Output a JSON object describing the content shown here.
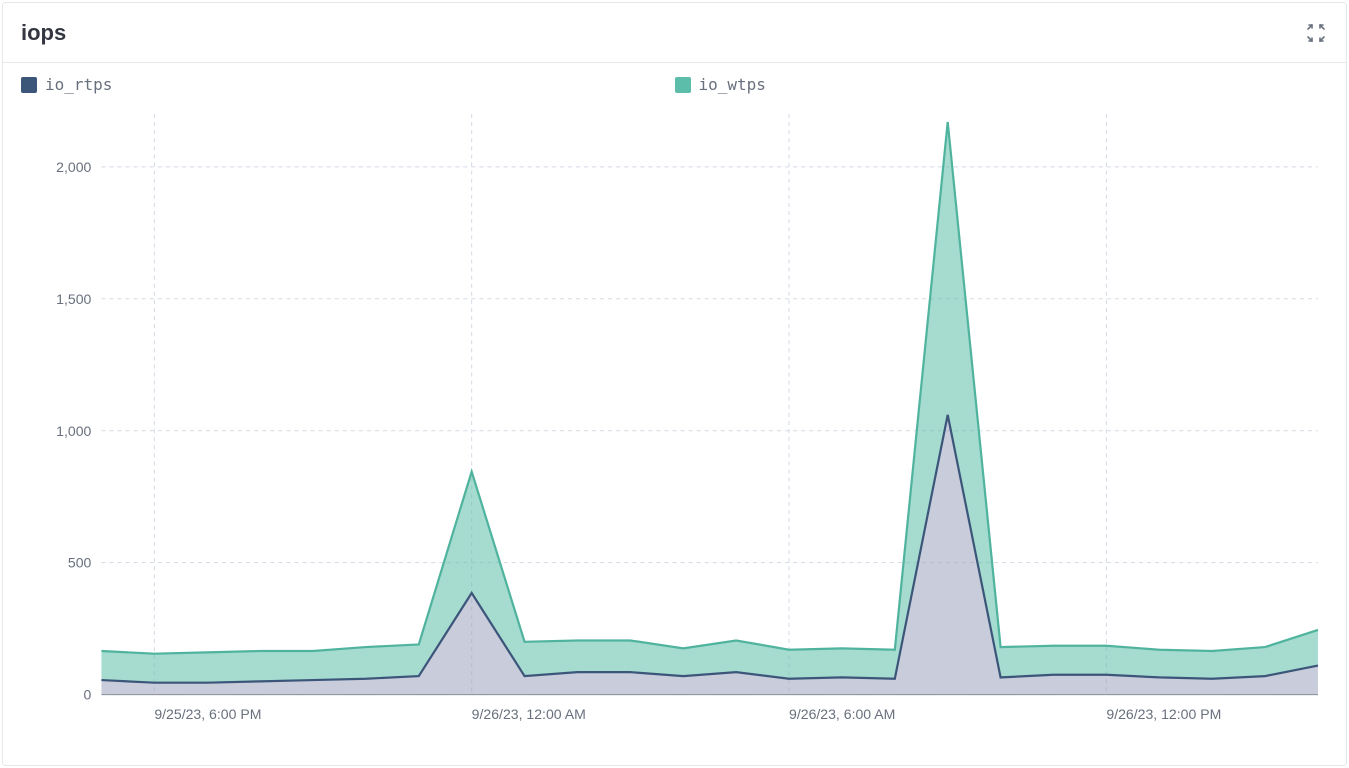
{
  "header": {
    "title": "iops",
    "collapse_icon": "collapse-icon"
  },
  "legend": {
    "items": [
      {
        "name": "io_rtps",
        "color": "#3c567a"
      },
      {
        "name": "io_wtps",
        "color": "#5cbeaa"
      }
    ]
  },
  "chart_data": {
    "type": "area",
    "title": "iops",
    "xlabel": "",
    "ylabel": "",
    "ylim": [
      0,
      2200
    ],
    "y_ticks": [
      0,
      500,
      1000,
      1500,
      2000
    ],
    "x_tick_labels": [
      "9/25/23, 6:00 PM",
      "9/26/23, 12:00 AM",
      "9/26/23, 6:00 AM",
      "9/26/23, 12:00 PM"
    ],
    "x_tick_indices": [
      1,
      7,
      13,
      19
    ],
    "x": [
      0,
      1,
      2,
      3,
      4,
      5,
      6,
      7,
      8,
      9,
      10,
      11,
      12,
      13,
      14,
      15,
      16,
      17,
      18,
      19,
      20,
      21,
      22,
      23
    ],
    "series": [
      {
        "name": "io_rtps",
        "color_line": "#3c567a",
        "color_fill": "#9aa3bd",
        "values": [
          55,
          45,
          45,
          50,
          55,
          60,
          70,
          385,
          70,
          85,
          85,
          70,
          85,
          60,
          65,
          60,
          1060,
          65,
          75,
          75,
          65,
          60,
          70,
          110
        ]
      },
      {
        "name": "io_wtps",
        "color_line": "#4fb39e",
        "color_fill": "#5cbeaa",
        "values": [
          110,
          110,
          115,
          115,
          110,
          120,
          120,
          460,
          130,
          120,
          120,
          105,
          120,
          110,
          110,
          110,
          1110,
          115,
          110,
          110,
          105,
          105,
          110,
          135
        ]
      }
    ]
  }
}
